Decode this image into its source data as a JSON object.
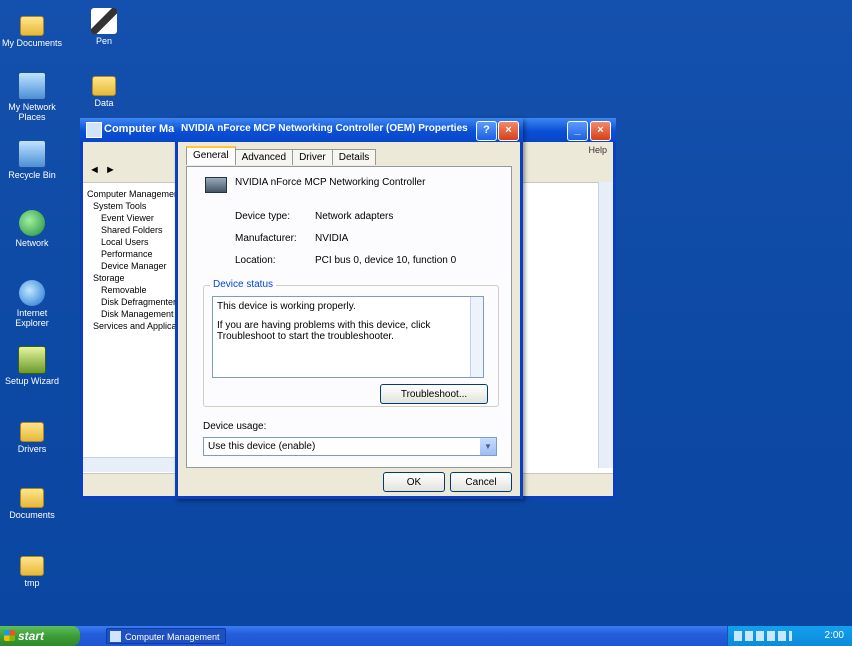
{
  "desktop": {
    "icons": [
      {
        "label": "My Documents",
        "icon": "folder-icon"
      },
      {
        "label": "Pen",
        "icon": "pen-icon"
      },
      {
        "label": "My Network Places",
        "icon": "computer-icon"
      },
      {
        "label": "Data",
        "icon": "folder-icon"
      },
      {
        "label": "Recycle Bin",
        "icon": "computer-icon"
      },
      {
        "label": "Network",
        "icon": "globe-icon"
      },
      {
        "label": "Internet Explorer",
        "icon": "ie-icon"
      },
      {
        "label": "Setup Wizard",
        "icon": "setup-icon"
      },
      {
        "label": "Drivers",
        "icon": "folder-icon"
      },
      {
        "label": "Documents",
        "icon": "folder-icon"
      },
      {
        "label": "tmp",
        "icon": "folder-icon"
      }
    ]
  },
  "explorer": {
    "title": "Computer Management",
    "menu_right": "Help",
    "tree": [
      "Computer Management",
      "System Tools",
      "Event Viewer",
      "Shared Folders",
      "Local Users",
      "Performance",
      "Device Manager",
      "Storage",
      "Removable",
      "Disk Defragmenter",
      "Disk Management",
      "Services and Applications"
    ]
  },
  "dialog": {
    "title": "NVIDIA nForce MCP Networking Controller (OEM) Properties",
    "tabs": [
      "General",
      "Advanced",
      "Driver",
      "Details"
    ],
    "device_name": "NVIDIA nForce MCP Networking Controller",
    "properties": [
      {
        "label": "Device type:",
        "value": "Network adapters"
      },
      {
        "label": "Manufacturer:",
        "value": "NVIDIA"
      },
      {
        "label": "Location:",
        "value": "PCI bus 0, device 10, function 0"
      }
    ],
    "status_group_label": "Device status",
    "status_line1": "This device is working properly.",
    "status_line2": "If you are having problems with this device, click Troubleshoot to start the troubleshooter.",
    "troubleshoot_label": "Troubleshoot...",
    "usage_label": "Device usage:",
    "usage_value": "Use this device (enable)",
    "ok_label": "OK",
    "cancel_label": "Cancel"
  },
  "taskbar": {
    "start_label": "start",
    "task_label": "Computer Management",
    "clock": "2:00"
  }
}
